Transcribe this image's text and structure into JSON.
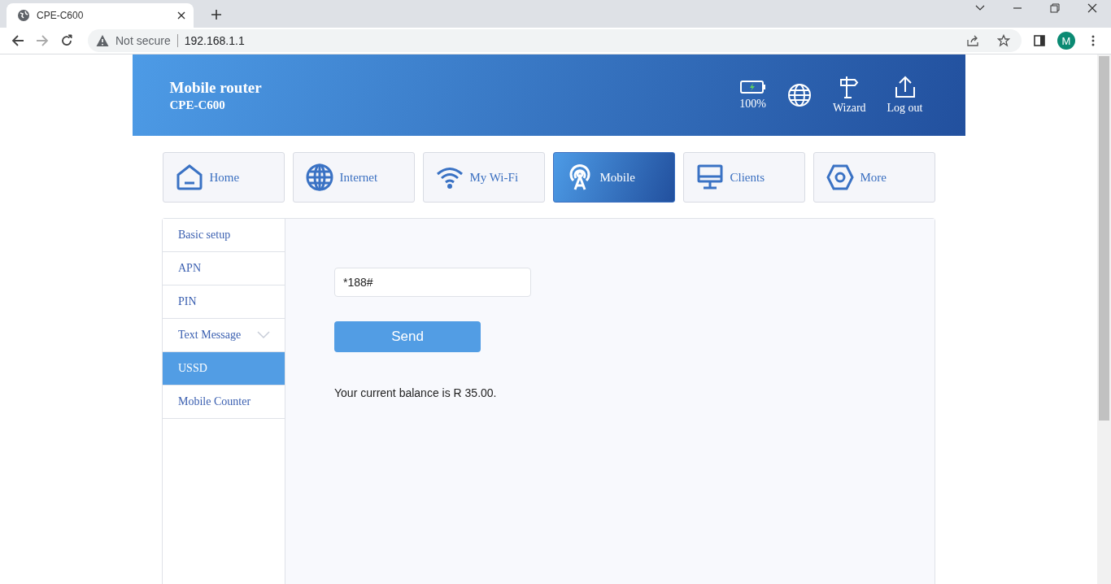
{
  "browser": {
    "tab_title": "CPE-C600",
    "security_label": "Not secure",
    "url": "192.168.1.1",
    "profile_initial": "M"
  },
  "header": {
    "title": "Mobile router",
    "subtitle": "CPE-C600",
    "battery_label": "100%",
    "actions": [
      {
        "kind": "signpost",
        "label": "Wizard"
      },
      {
        "kind": "upload",
        "label": "Log out"
      }
    ]
  },
  "nav": [
    {
      "kind": "home",
      "label": "Home",
      "selected": false
    },
    {
      "kind": "globe",
      "label": "Internet",
      "selected": false
    },
    {
      "kind": "wifi",
      "label": "My Wi-Fi",
      "selected": false
    },
    {
      "kind": "antenna",
      "label": "Mobile",
      "selected": true
    },
    {
      "kind": "monitor",
      "label": "Clients",
      "selected": false
    },
    {
      "kind": "hexagon",
      "label": "More",
      "selected": false
    }
  ],
  "sidebar": [
    {
      "kind": "link",
      "label": "Basic setup",
      "selected": false
    },
    {
      "kind": "link",
      "label": "APN",
      "selected": false
    },
    {
      "kind": "link",
      "label": "PIN",
      "selected": false
    },
    {
      "kind": "group",
      "label": "Text Message",
      "selected": false,
      "expanded": false
    },
    {
      "kind": "link",
      "label": "USSD",
      "selected": true
    },
    {
      "kind": "link",
      "label": "Mobile Counter",
      "selected": false
    }
  ],
  "ussd": {
    "value": "*188#",
    "button": "Send",
    "response": "Your current balance is R 35.00."
  }
}
